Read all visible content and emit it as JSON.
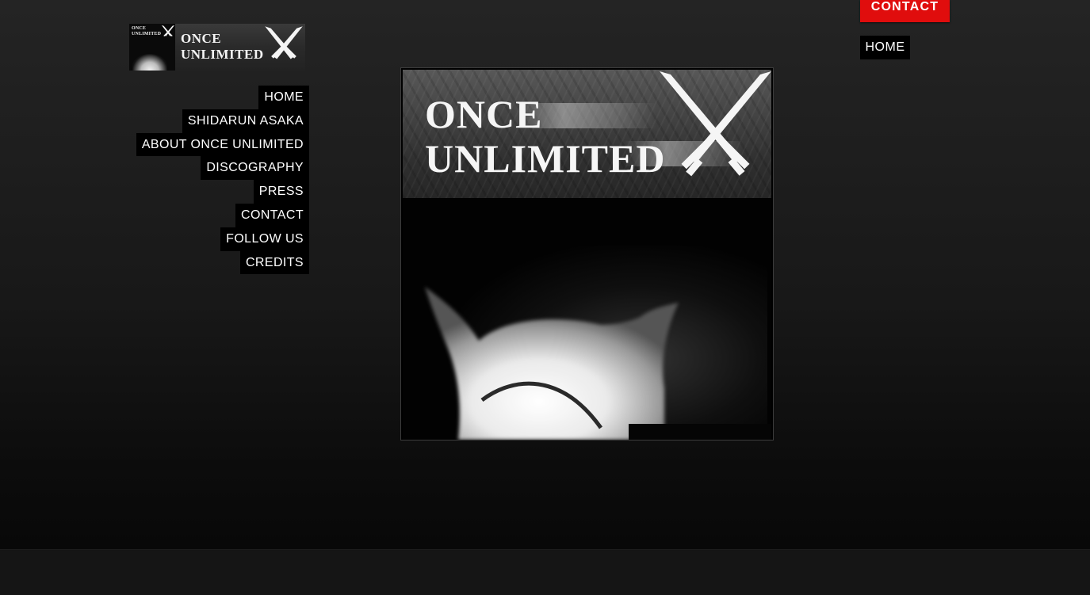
{
  "logo": {
    "line1": "ONCE",
    "line2": "UNLIMITED",
    "tiny_line1": "ONCE",
    "tiny_line2": "UNLIMITED"
  },
  "side_nav": {
    "items": [
      {
        "label": "HOME"
      },
      {
        "label": "SHIDARUN ASAKA"
      },
      {
        "label": "ABOUT ONCE UNLIMITED"
      },
      {
        "label": "DISCOGRAPHY"
      },
      {
        "label": "PRESS"
      },
      {
        "label": "CONTACT"
      },
      {
        "label": "FOLLOW US"
      },
      {
        "label": "CREDITS"
      }
    ]
  },
  "top_nav": {
    "contact_label": "CONTACT",
    "home_label": "HOME"
  },
  "artwork": {
    "title_line1": "ONCE",
    "title_line2": "UNLIMITED"
  },
  "colors": {
    "accent": "#e00d0d",
    "background_top": "#242424",
    "background_bottom": "#080808",
    "nav_background": "#000000",
    "text": "#ffffff"
  },
  "icons": [
    "crossed-swords-icon"
  ]
}
